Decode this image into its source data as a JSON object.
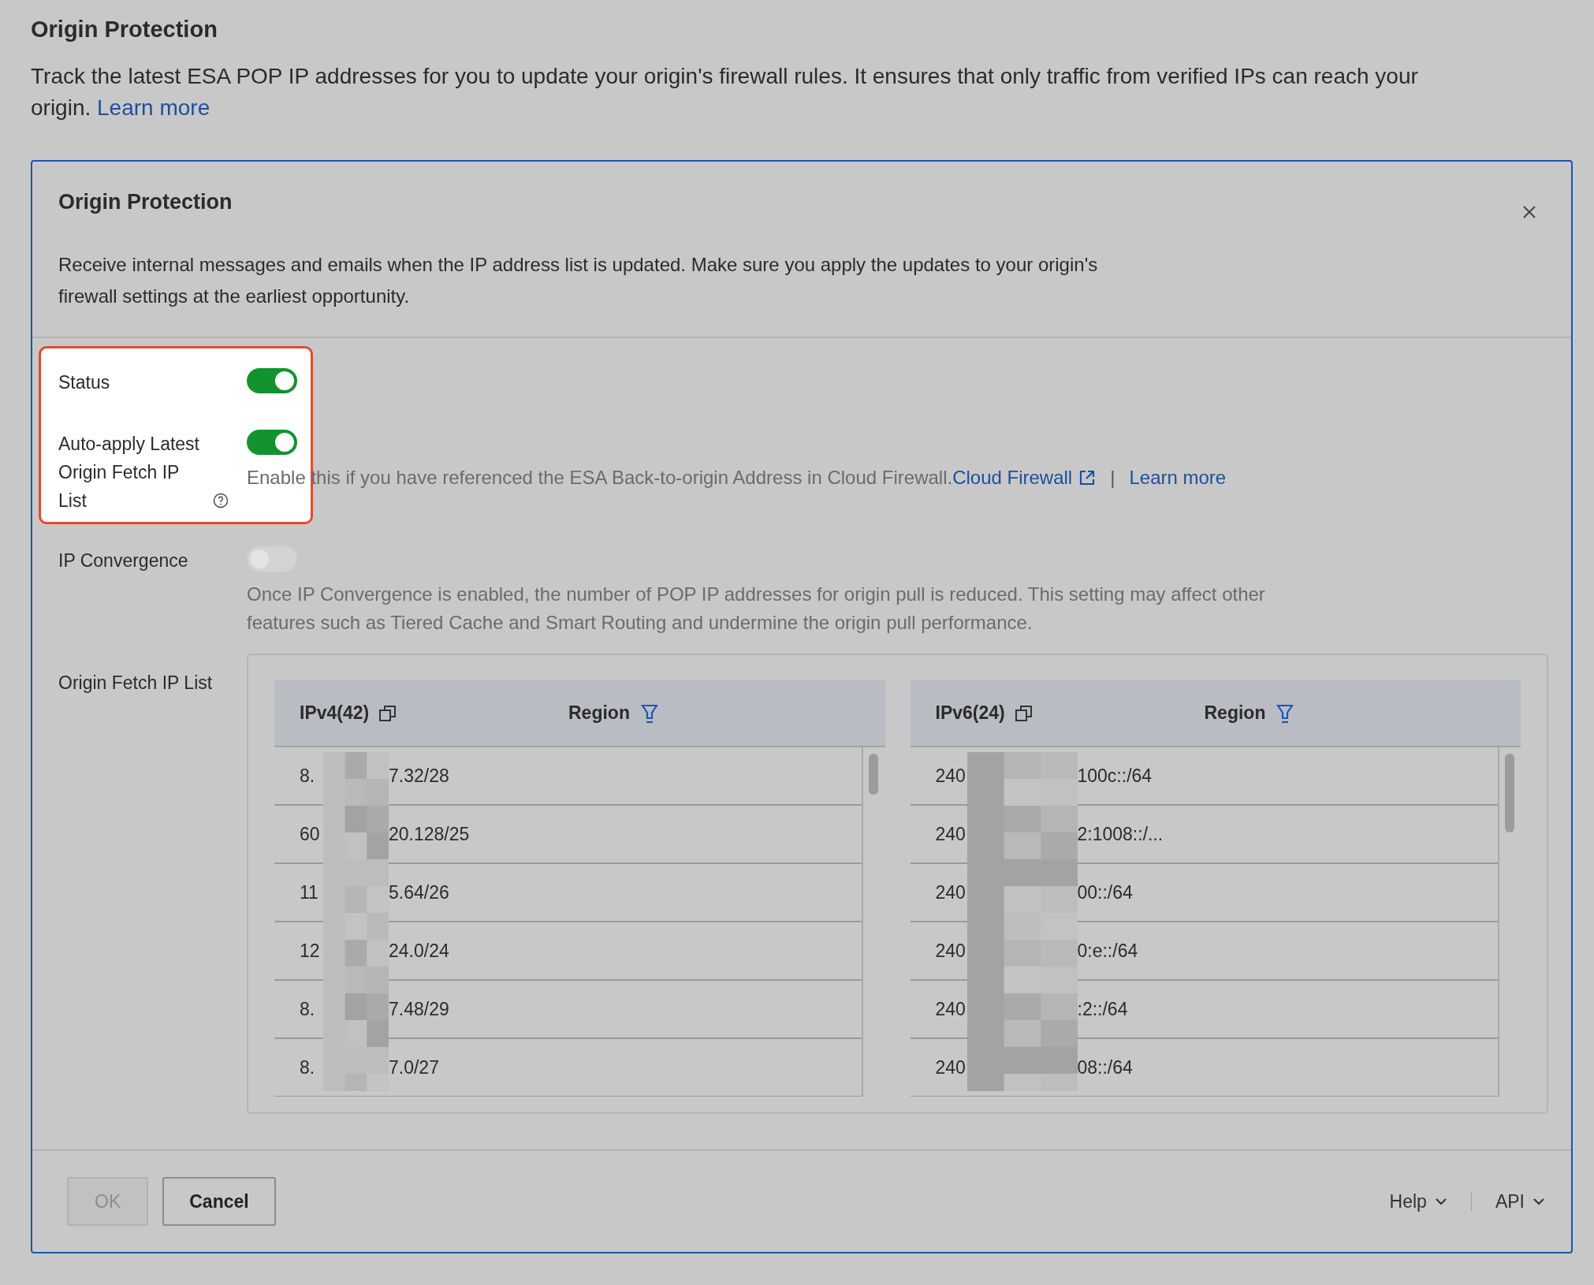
{
  "page": {
    "title": "Origin Protection",
    "description": "Track the latest ESA POP IP addresses for you to update your origin's firewall rules. It ensures that only traffic from verified IPs can reach your origin. ",
    "link": "Learn more"
  },
  "dialog": {
    "title": "Origin Protection",
    "description": "Receive internal messages and emails when the IP address list is updated. Make sure you apply the updates to your origin's firewall settings at the earliest opportunity.",
    "settings": [
      {
        "kind": "toggle",
        "label": "Status",
        "on": true,
        "highlighted": true
      },
      {
        "kind": "toggle",
        "label": "Auto-apply Latest Origin Fetch IP List",
        "help": true,
        "on": true,
        "highlighted": true,
        "hint": "Enable this if you have referenced the ESA Back-to-origin Address in Cloud Firewall.",
        "links": [
          {
            "text": "Cloud Firewall",
            "external": true
          },
          {
            "text": "Learn more",
            "external": false
          }
        ],
        "separator": "|"
      },
      {
        "kind": "toggle",
        "label": "IP Convergence",
        "on": false,
        "highlighted": false,
        "hint": "Once IP Convergence is enabled, the number of POP IP addresses for origin pull is reduced. This setting may affect other features such as Tiered Cache and Smart Routing and undermine the origin pull performance."
      },
      {
        "kind": "tables",
        "label": "Origin Fetch IP List"
      }
    ],
    "tables": [
      {
        "title": "IPv4(42)",
        "column_2": "Region",
        "rows": [
          {
            "prefix": "8.",
            "suffix": "7.32/28"
          },
          {
            "prefix": "60",
            "suffix": "20.128/25"
          },
          {
            "prefix": "11",
            "suffix": "5.64/26"
          },
          {
            "prefix": "12",
            "suffix": "24.0/24"
          },
          {
            "prefix": "8.",
            "suffix": "7.48/29"
          },
          {
            "prefix": "8.",
            "suffix": "7.0/27"
          }
        ]
      },
      {
        "title": "IPv6(24)",
        "column_2": "Region",
        "rows": [
          {
            "prefix": "240",
            "suffix": "100c::/64"
          },
          {
            "prefix": "240",
            "suffix": "2:1008::/..."
          },
          {
            "prefix": "240",
            "suffix": "00::/64"
          },
          {
            "prefix": "240",
            "suffix": "0:e::/64"
          },
          {
            "prefix": "240",
            "suffix": ":2::/64"
          },
          {
            "prefix": "240",
            "suffix": "08::/64"
          }
        ]
      }
    ],
    "buttons": [
      {
        "label": "OK",
        "disabled": true
      },
      {
        "label": "Cancel",
        "disabled": false
      }
    ],
    "menus": [
      "Help",
      "API"
    ]
  }
}
